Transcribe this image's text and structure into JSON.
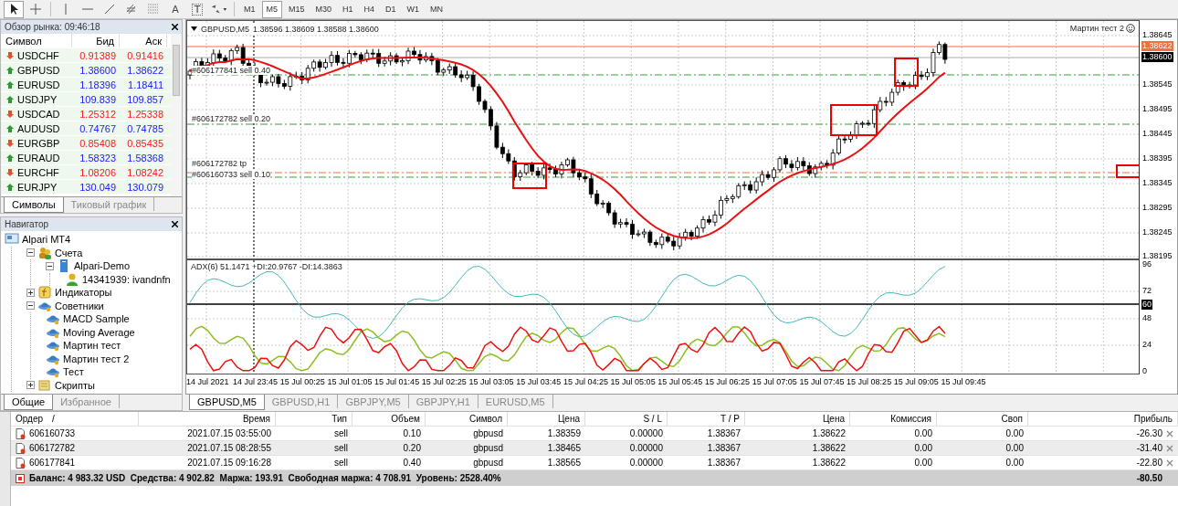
{
  "toolbar": {
    "tools": [
      {
        "kind": "cursor",
        "selected": true
      },
      {
        "kind": "crosshair",
        "selected": false
      },
      {
        "kind": "vline",
        "selected": false
      },
      {
        "kind": "hline",
        "selected": false
      },
      {
        "kind": "trendline",
        "selected": false
      },
      {
        "kind": "fibo",
        "selected": false
      },
      {
        "kind": "channel",
        "selected": false
      },
      {
        "kind": "text",
        "label": "A",
        "selected": false
      },
      {
        "kind": "label",
        "label": "T",
        "selected": false
      },
      {
        "kind": "arrows",
        "selected": false
      }
    ],
    "timeframes": [
      {
        "label": "M1",
        "selected": false
      },
      {
        "label": "M5",
        "selected": true
      },
      {
        "label": "M15",
        "selected": false
      },
      {
        "label": "M30",
        "selected": false
      },
      {
        "label": "H1",
        "selected": false
      },
      {
        "label": "H4",
        "selected": false
      },
      {
        "label": "D1",
        "selected": false
      },
      {
        "label": "W1",
        "selected": false
      },
      {
        "label": "MN",
        "selected": false
      }
    ]
  },
  "market_watch": {
    "title": "Обзор рынка: 09:46:18",
    "columns": [
      "Символ",
      "Бид",
      "Аск"
    ],
    "rows": [
      {
        "symbol": "USDCHF",
        "bid": "0.91389",
        "ask": "0.91416",
        "rising": false
      },
      {
        "symbol": "GBPUSD",
        "bid": "1.38600",
        "ask": "1.38622",
        "rising": true
      },
      {
        "symbol": "EURUSD",
        "bid": "1.18396",
        "ask": "1.18411",
        "rising": true
      },
      {
        "symbol": "USDJPY",
        "bid": "109.839",
        "ask": "109.857",
        "rising": true
      },
      {
        "symbol": "USDCAD",
        "bid": "1.25312",
        "ask": "1.25338",
        "rising": false
      },
      {
        "symbol": "AUDUSD",
        "bid": "0.74767",
        "ask": "0.74785",
        "rising": true
      },
      {
        "symbol": "EURGBP",
        "bid": "0.85408",
        "ask": "0.85435",
        "rising": false
      },
      {
        "symbol": "EURAUD",
        "bid": "1.58323",
        "ask": "1.58368",
        "rising": true
      },
      {
        "symbol": "EURCHF",
        "bid": "1.08206",
        "ask": "1.08242",
        "rising": false
      },
      {
        "symbol": "EURJPY",
        "bid": "130.049",
        "ask": "130.079",
        "rising": true
      }
    ],
    "tabs": [
      {
        "label": "Символы",
        "selected": true
      },
      {
        "label": "Тиковый график",
        "selected": false
      }
    ]
  },
  "navigator": {
    "title": "Навигатор",
    "tree": [
      {
        "label": "Alpari MT4",
        "kind": "terminal",
        "children": [
          {
            "label": "Счета",
            "kind": "accounts",
            "expanded": true,
            "children": [
              {
                "label": "Alpari-Demo",
                "kind": "server",
                "expanded": true,
                "children": [
                  {
                    "label": "14341939: ivandnfn",
                    "kind": "user"
                  }
                ]
              }
            ]
          },
          {
            "label": "Индикаторы",
            "kind": "indicators",
            "expanded": false
          },
          {
            "label": "Советники",
            "kind": "experts",
            "expanded": true,
            "children": [
              {
                "label": "MACD Sample",
                "kind": "expert"
              },
              {
                "label": "Moving Average",
                "kind": "expert"
              },
              {
                "label": "Мартин тест",
                "kind": "expert"
              },
              {
                "label": "Мартин тест 2",
                "kind": "expert"
              },
              {
                "label": "Тест",
                "kind": "expert"
              }
            ]
          },
          {
            "label": "Скрипты",
            "kind": "scripts",
            "expanded": false
          }
        ]
      }
    ],
    "tabs": [
      {
        "label": "Общие",
        "selected": true
      },
      {
        "label": "Избранное",
        "selected": false
      }
    ]
  },
  "chart": {
    "symbol": "GBPUSD,M5",
    "quotes": "1.38596 1.38609 1.38588 1.38600",
    "expert": "Мартин тест 2",
    "order_labels": [
      "#606177841 sell 0.40",
      "#606172782 sell 0.20",
      "#606172782 tp",
      "#606160733 sell 0.10"
    ],
    "price_axis": [
      {
        "label": "1.38645",
        "kind": "tick"
      },
      {
        "label": "1.38622",
        "kind": "ask"
      },
      {
        "label": "1.38600",
        "kind": "bid"
      },
      {
        "label": "1.38545",
        "kind": "tick"
      },
      {
        "label": "1.38495",
        "kind": "tick"
      },
      {
        "label": "1.38445",
        "kind": "tick"
      },
      {
        "label": "1.38395",
        "kind": "tick"
      },
      {
        "label": "1.38345",
        "kind": "tick"
      },
      {
        "label": "1.38295",
        "kind": "tick"
      },
      {
        "label": "1.38245",
        "kind": "tick"
      },
      {
        "label": "1.38195",
        "kind": "tick"
      }
    ],
    "indicator": {
      "label": "ADX(6) 51.1471 +DI:20.9767 -DI:14.3863",
      "axis": [
        {
          "label": "96",
          "kind": "tick"
        },
        {
          "label": "72",
          "kind": "tick"
        },
        {
          "label": "60",
          "kind": "level"
        },
        {
          "label": "48",
          "kind": "tick"
        },
        {
          "label": "24",
          "kind": "tick"
        },
        {
          "label": "0",
          "kind": "tick"
        }
      ]
    },
    "time_axis": [
      "14 Jul 2021",
      "14 Jul 23:45",
      "15 Jul 00:25",
      "15 Jul 01:05",
      "15 Jul 01:45",
      "15 Jul 02:25",
      "15 Jul 03:05",
      "15 Jul 03:45",
      "15 Jul 04:25",
      "15 Jul 05:05",
      "15 Jul 05:45",
      "15 Jul 06:25",
      "15 Jul 07:05",
      "15 Jul 07:45",
      "15 Jul 08:25",
      "15 Jul 09:05",
      "15 Jul 09:45"
    ],
    "tabs": [
      {
        "label": "GBPUSD,M5",
        "selected": true
      },
      {
        "label": "GBPUSD,H1",
        "selected": false
      },
      {
        "label": "GBPJPY,M5",
        "selected": false
      },
      {
        "label": "GBPJPY,H1",
        "selected": false
      },
      {
        "label": "EURUSD,M5",
        "selected": false
      }
    ]
  },
  "terminal": {
    "columns": [
      {
        "label": "Ордер",
        "sort_mark": "/"
      },
      {
        "label": "Время"
      },
      {
        "label": "Тип"
      },
      {
        "label": "Объем"
      },
      {
        "label": "Символ"
      },
      {
        "label": "Цена"
      },
      {
        "label": "S / L"
      },
      {
        "label": "T / P"
      },
      {
        "label": "Цена"
      },
      {
        "label": "Комиссия"
      },
      {
        "label": "Своп"
      },
      {
        "label": "Прибыль"
      }
    ],
    "rows": [
      {
        "cells": [
          "606160733",
          "2021.07.15 03:55:00",
          "sell",
          "0.10",
          "gbpusd",
          "1.38359",
          "0.00000",
          "1.38367",
          "1.38622",
          "0.00",
          "0.00",
          "-26.30"
        ]
      },
      {
        "cells": [
          "606172782",
          "2021.07.15 08:28:55",
          "sell",
          "0.20",
          "gbpusd",
          "1.38465",
          "0.00000",
          "1.38367",
          "1.38622",
          "0.00",
          "0.00",
          "-31.40"
        ]
      },
      {
        "cells": [
          "606177841",
          "2021.07.15 09:16:28",
          "sell",
          "0.40",
          "gbpusd",
          "1.38565",
          "0.00000",
          "1.38367",
          "1.38622",
          "0.00",
          "0.00",
          "-22.80"
        ]
      }
    ],
    "summary": "Баланс: 4 983.32 USD  Средства: 4 902.82  Маржа: 193.91  Свободная маржа: 4 708.91  Уровень: 2528.40%",
    "total": "-80.50"
  }
}
